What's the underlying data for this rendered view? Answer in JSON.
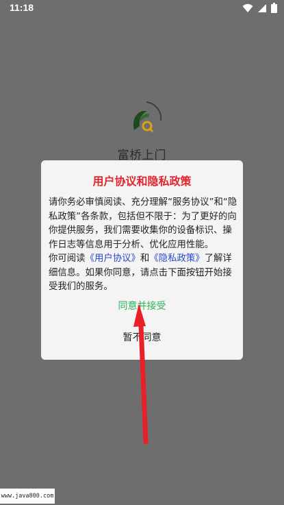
{
  "status_bar": {
    "time": "11:18",
    "icons": [
      "wifi-icon",
      "signal-icon",
      "battery-icon"
    ]
  },
  "splash": {
    "app_name": "富桥上门",
    "logo_icon": "app-logo-icon"
  },
  "dialog": {
    "title": "用户协议和隐私政策",
    "paragraph1": "请你务必审慎阅读、充分理解“服务协议”和“隐私政策”各条款，包括但不限于：为了更好的向你提供服务，我们需要收集你的设备标识、操作日志等信息用于分析、优化应用性能。",
    "p2_prefix": "你可阅读",
    "user_agreement_link": "《用户协议》",
    "p2_and": "和",
    "privacy_policy_link": "《隐私政策》",
    "p2_suffix": "了解详细信息。如果你同意，请点击下面按钮开始接受我们的服务。",
    "agree_label": "同意并接受",
    "decline_label": "暂不同意"
  },
  "watermark": {
    "text": "www.java800.com"
  },
  "colors": {
    "overlay_background": "#6e6e6e",
    "dialog_background": "#f4f4f4",
    "title_red": "#e0262c",
    "link_blue": "#2b47c9",
    "agree_green": "#2eb25b",
    "arrow_red": "#e8202a"
  }
}
